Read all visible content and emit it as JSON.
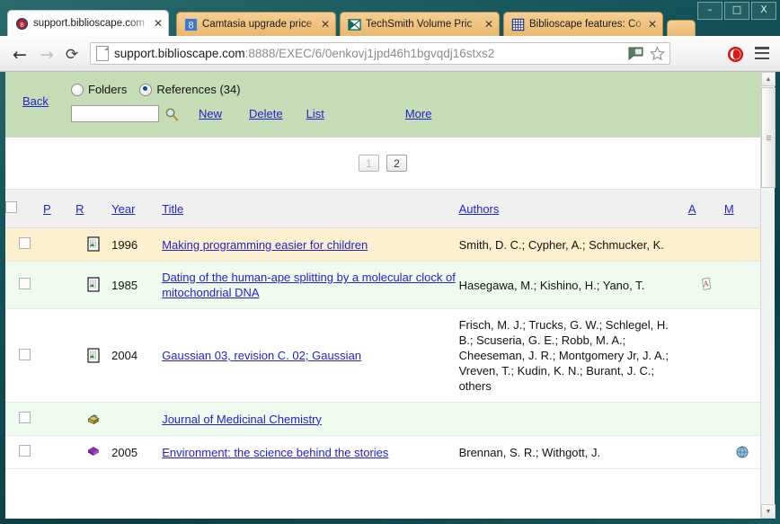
{
  "window": {
    "minimize_label": "–",
    "maximize_label": "□",
    "close_label": "X"
  },
  "browser": {
    "tabs": [
      {
        "title": "support.biblioscape.com",
        "favicon": "biblioscape-globe-icon",
        "active": true,
        "close_label": "✕"
      },
      {
        "title": "Camtasia upgrade price",
        "favicon": "google-g-icon",
        "active": false,
        "close_label": "✕"
      },
      {
        "title": "TechSmith Volume Pric",
        "favicon": "techsmith-icon",
        "active": false,
        "close_label": "✕"
      },
      {
        "title": "Biblioscape features: Co",
        "favicon": "grid-window-icon",
        "active": false,
        "close_label": "✕"
      }
    ],
    "nav": {
      "back_label": "←",
      "forward_label": "→",
      "reload_label": "⟳"
    },
    "omnibox": {
      "url_host": "support.biblioscape.com",
      "url_rest": ":8888/EXEC/6/0enkovj1jpd46h1bgvqdj16stxs2",
      "page_icon": "document-icon",
      "translate_icon": "translate-flag-icon",
      "bookmark_icon": "star-icon",
      "extension_icon": "opera-adblock-icon",
      "menu_icon": "hamburger-menu-icon"
    }
  },
  "page": {
    "toolbar": {
      "back_label": "Back",
      "folders_label": "Folders",
      "references_label": "References (34)",
      "folders_selected": false,
      "references_selected": true,
      "search_value": "",
      "search_placeholder": "",
      "search_icon": "magnifier-icon",
      "new_label": "New",
      "delete_label": "Delete",
      "list_label": "List",
      "more_label": "More"
    },
    "pagination": {
      "pages": [
        "1",
        "2"
      ],
      "current": "2"
    },
    "table": {
      "headers": {
        "select_all": "",
        "p": "P",
        "r": "R",
        "year": "Year",
        "title": "Title",
        "authors": "Authors",
        "a": "A",
        "m": "M"
      },
      "rows": [
        {
          "highlight": "selected",
          "type_icon": "journal-article-icon",
          "year": "1996",
          "title": "Making programming easier for children",
          "authors": "Smith, D. C.; Cypher, A.; Schmucker, K.",
          "attachment_icon": "",
          "media_icon": ""
        },
        {
          "highlight": "alt",
          "type_icon": "journal-article-icon",
          "year": "1985",
          "title": "Dating of the human-ape splitting by a molecular clock of mitochondrial DNA",
          "authors": "Hasegawa, M.; Kishino, H.; Yano, T.",
          "attachment_icon": "pdf-icon",
          "media_icon": ""
        },
        {
          "highlight": "plain",
          "type_icon": "journal-article-icon",
          "year": "2004",
          "title": "Gaussian 03, revision C. 02; Gaussian",
          "authors": "Frisch, M. J.; Trucks, G. W.; Schlegel, H. B.; Scuseria, G. E.; Robb, M. A.; Cheeseman, J. R.; Montgomery Jr, J. A.; Vreven, T.; Kudin, K. N.; Burant, J. C.; others",
          "attachment_icon": "",
          "media_icon": ""
        },
        {
          "highlight": "alt",
          "type_icon": "journal-stack-icon",
          "year": "",
          "title": "Journal of Medicinal Chemistry",
          "authors": "",
          "attachment_icon": "",
          "media_icon": ""
        },
        {
          "highlight": "plain",
          "type_icon": "book-icon",
          "year": "2005",
          "title": "Environment: the science behind the stories",
          "authors": "Brennan, S. R.; Withgott, J.",
          "attachment_icon": "",
          "media_icon": "globe-icon"
        }
      ]
    },
    "scrollbar": {
      "up_arrow": "▲",
      "down_arrow": "▼"
    }
  },
  "colors": {
    "window_frame": "#14545a",
    "toolbar_green": "#c5ddb7",
    "link_blue": "#2222cc",
    "row_selected": "#fdf0ce",
    "row_alt": "#f0fbf0",
    "header_gray": "#f0f0f0"
  }
}
